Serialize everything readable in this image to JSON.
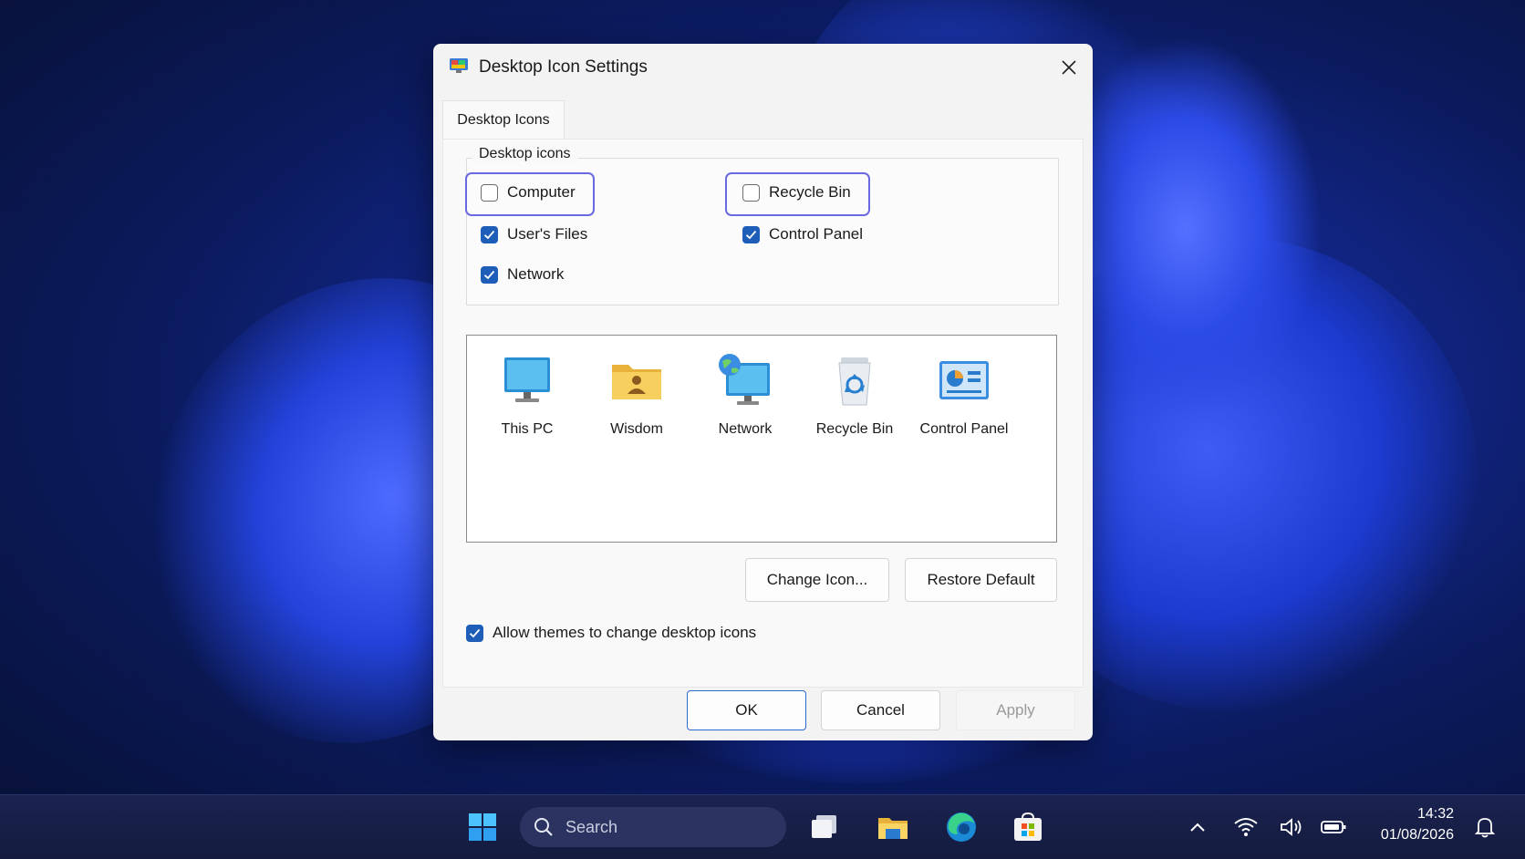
{
  "dialog": {
    "title": "Desktop Icon Settings",
    "tab": "Desktop Icons",
    "group_label": "Desktop icons",
    "checkboxes": [
      {
        "label": "Computer",
        "checked": false
      },
      {
        "label": "Recycle Bin",
        "checked": false
      },
      {
        "label": "User's Files",
        "checked": true
      },
      {
        "label": "Control Panel",
        "checked": true
      },
      {
        "label": "Network",
        "checked": true
      }
    ],
    "icons": [
      {
        "label": "This PC",
        "icon": "monitor-icon"
      },
      {
        "label": "Wisdom",
        "icon": "user-folder-icon"
      },
      {
        "label": "Network",
        "icon": "network-globe-icon"
      },
      {
        "label": "Recycle Bin",
        "icon": "recycle-bin-icon"
      },
      {
        "label": "Control Panel",
        "icon": "control-panel-icon"
      }
    ],
    "change_icon": "Change Icon...",
    "restore_default": "Restore Default",
    "allow_themes": {
      "label": "Allow themes to change desktop icons",
      "checked": true
    },
    "ok": "OK",
    "cancel": "Cancel",
    "apply": "Apply"
  },
  "taskbar": {
    "search_placeholder": "Search",
    "time": "14:32",
    "date": "01/08/2026"
  },
  "colors": {
    "accent": "#1f5eb8",
    "focus": "#6a6ae0"
  }
}
